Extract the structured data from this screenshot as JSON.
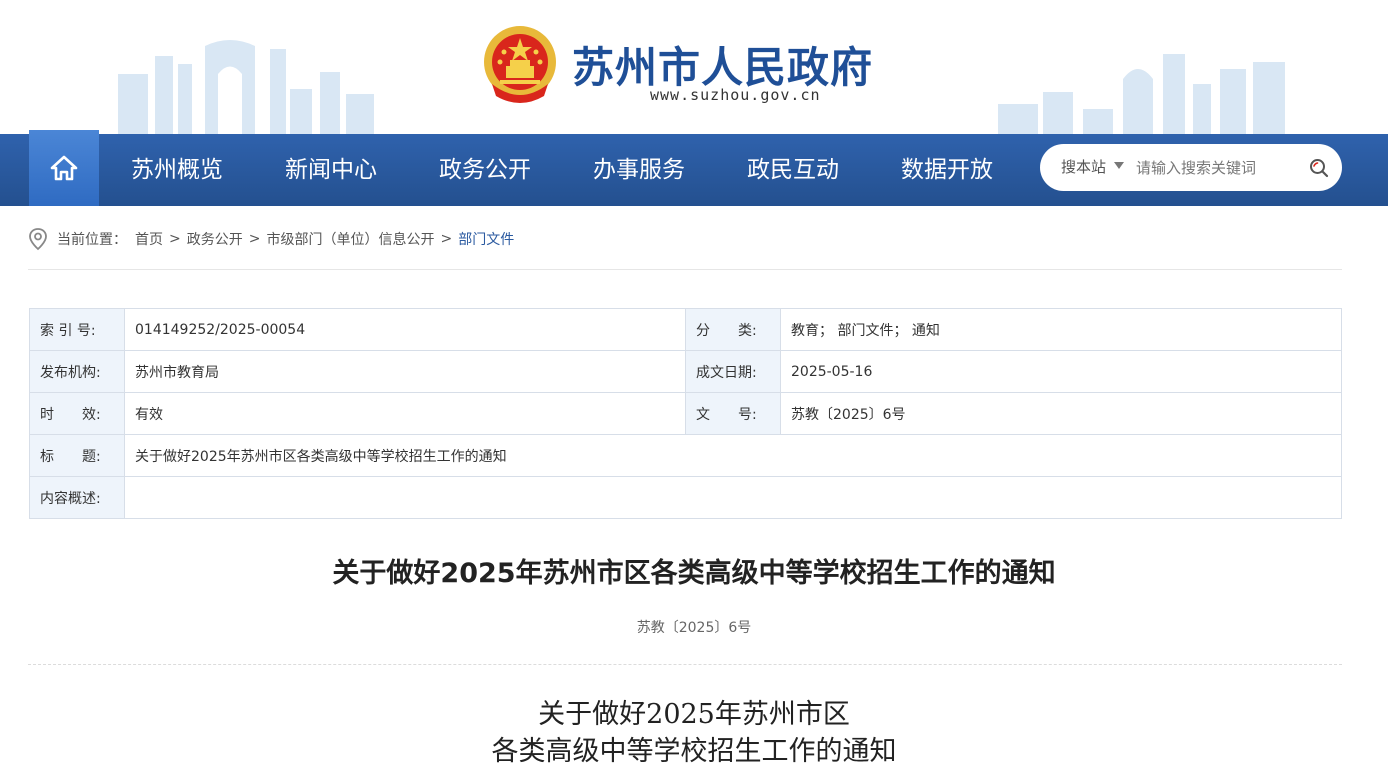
{
  "header": {
    "site_title": "苏州市人民政府",
    "site_url": "www.suzhou.gov.cn",
    "brand_color": "#1f4f97"
  },
  "nav": {
    "home_icon": "home-icon",
    "items": [
      "苏州概览",
      "新闻中心",
      "政务公开",
      "办事服务",
      "政民互动",
      "数据开放"
    ],
    "bg_color": "#2b5aa0",
    "search": {
      "scope_label": "搜本站",
      "placeholder": "请输入搜索关键词",
      "icon": "search-icon"
    }
  },
  "breadcrumb": {
    "icon": "location-pin-icon",
    "prefix": "当前位置：",
    "items": [
      "首页",
      "政务公开",
      "市级部门（单位）信息公开",
      "部门文件"
    ],
    "separator": ">"
  },
  "info": {
    "index_label": "索 引 号:",
    "index_value": "014149252/2025-00054",
    "category_label": "分　　类:",
    "category_value": "教育；  部门文件；  通知",
    "publisher_label": "发布机构:",
    "publisher_value": "苏州市教育局",
    "date_label": "成文日期:",
    "date_value": "2025-05-16",
    "validity_label": "时　　效:",
    "validity_value": "有效",
    "docno_label": "文　　号:",
    "docno_value": "苏教〔2025〕6号",
    "title_label": "标　　题:",
    "title_value": "关于做好2025年苏州市区各类高级中等学校招生工作的通知",
    "summary_label": "内容概述:",
    "summary_value": ""
  },
  "article": {
    "title": "关于做好2025年苏州市区各类高级中等学校招生工作的通知",
    "doc_number": "苏教〔2025〕6号",
    "body_title_line1": "关于做好2025年苏州市区",
    "body_title_line2": "各类高级中等学校招生工作的通知"
  }
}
